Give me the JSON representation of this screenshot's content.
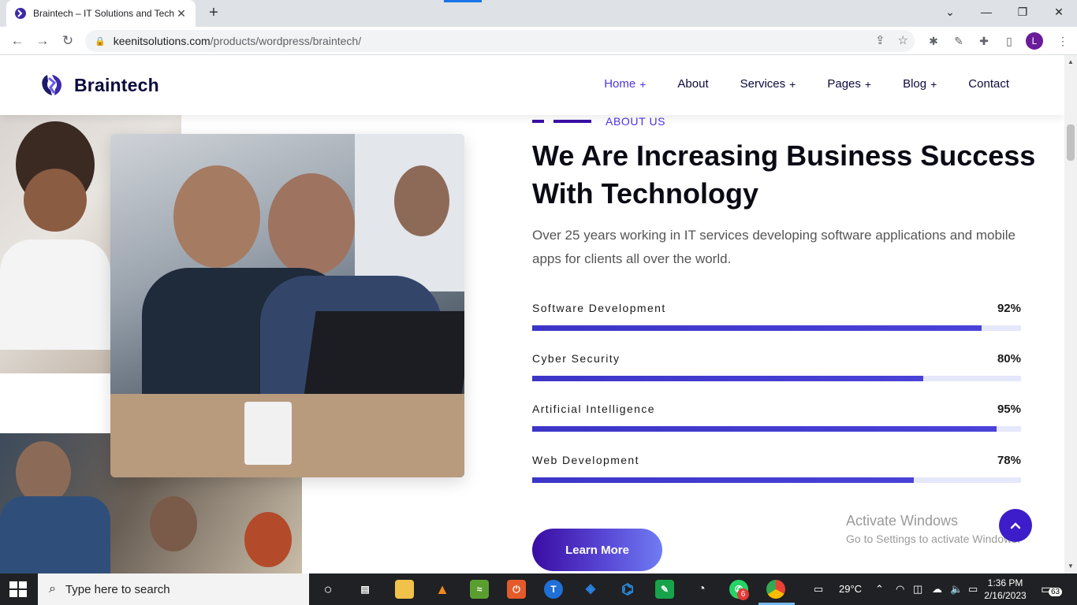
{
  "browser": {
    "tab_title": "Braintech – IT Solutions and Tech",
    "url_host": "keenitsolutions.com",
    "url_path": "/products/wordpress/braintech/",
    "profile_initial": "L"
  },
  "site": {
    "brand": "Braintech",
    "nav": [
      {
        "label": "Home",
        "plus": "+"
      },
      {
        "label": "About",
        "plus": ""
      },
      {
        "label": "Services",
        "plus": "+"
      },
      {
        "label": "Pages",
        "plus": "+"
      },
      {
        "label": "Blog",
        "plus": "+"
      },
      {
        "label": "Contact",
        "plus": ""
      }
    ],
    "accent": "#4e34e4"
  },
  "about": {
    "label": "ABOUT US",
    "headline_line1": "We Are Increasing Business Success",
    "headline_line2": "With Technology",
    "lede": "Over 25 years working in IT services developing software applications and mobile apps for clients all over the world.",
    "skills": [
      {
        "name": "Software Development",
        "value": 92,
        "label": "92%"
      },
      {
        "name": "Cyber Security",
        "value": 80,
        "label": "80%"
      },
      {
        "name": "Artificial Intelligence",
        "value": 95,
        "label": "95%"
      },
      {
        "name": "Web Development",
        "value": 78,
        "label": "78%"
      }
    ],
    "cta": "Learn More"
  },
  "watermark": {
    "line1": "Activate Windows",
    "line2": "Go to Settings to activate Windows."
  },
  "taskbar": {
    "search_placeholder": "Type here to search",
    "temperature": "29°C",
    "time": "1:36 PM",
    "date": "2/16/2023",
    "whatsapp_badge": "6",
    "notification_count": "63"
  }
}
